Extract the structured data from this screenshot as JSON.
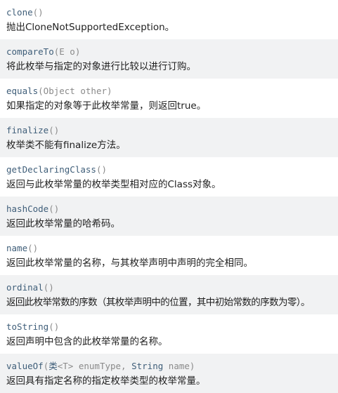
{
  "methods": [
    {
      "name": "clone",
      "params_pre": "()",
      "description": "抛出CloneNotSupportedException。"
    },
    {
      "name": "compareTo",
      "params_pre": "(E o)",
      "description": "将此枚举与指定的对象进行比较以进行订购。"
    },
    {
      "name": "equals",
      "params_pre": "(Object other)",
      "description": "如果指定的对象等于此枚举常量，则返回true。"
    },
    {
      "name": "finalize",
      "params_pre": "()",
      "description": "枚举类不能有finalize方法。"
    },
    {
      "name": "getDeclaringClass",
      "params_pre": "()",
      "description": "返回与此枚举常量的枚举类型相对应的Class对象。"
    },
    {
      "name": "hashCode",
      "params_pre": "()",
      "description": "返回此枚举常量的哈希码。"
    },
    {
      "name": "name",
      "params_pre": "()",
      "description": "返回此枚举常量的名称，与其枚举声明中声明的完全相同。"
    },
    {
      "name": "ordinal",
      "params_pre": "()",
      "description": "返回此枚举常数的序数（其枚举声明中的位置，其中初始常数的序数为零）。"
    },
    {
      "name": "toString",
      "params_pre": "()",
      "description": "返回声明中包含的此枚举常量的名称。"
    },
    {
      "name": "valueOf",
      "params_open": "(",
      "params_class": "类",
      "params_generic": "<T>",
      "params_mid": " enumType, ",
      "params_string": "String",
      "params_end": " name)",
      "description": "返回具有指定名称的指定枚举类型的枚举常量。"
    }
  ]
}
